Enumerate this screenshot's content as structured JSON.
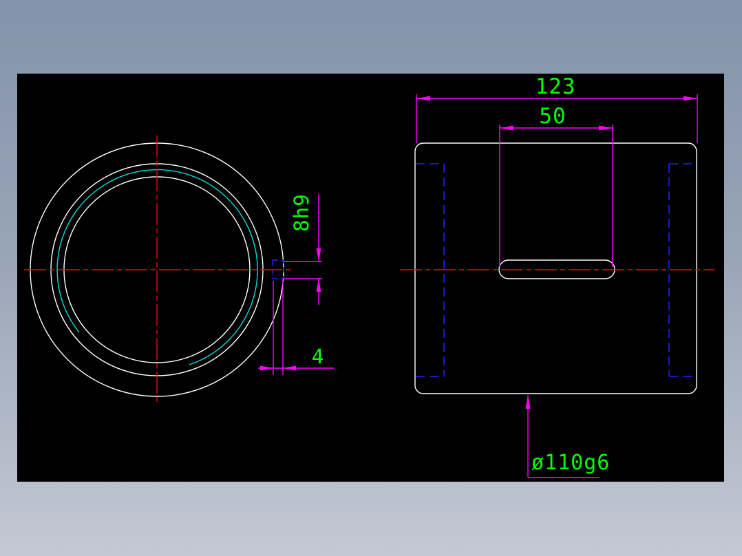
{
  "colors": {
    "background_top": "#8493aa",
    "background_bottom": "#c3c9d4",
    "canvas": "#000000",
    "outline": "#ffffff",
    "hidden_line": "#2222ff",
    "centerline": "#ff0000",
    "dimension_line": "#ff00ff",
    "dimension_text": "#00ff00",
    "groove_arc": "#00dcdc"
  },
  "dimensions": {
    "overall_length": "123",
    "keyway_length": "50",
    "keyway_width": "8h9",
    "keyway_depth": "4",
    "outer_diameter": "ø110g6"
  }
}
